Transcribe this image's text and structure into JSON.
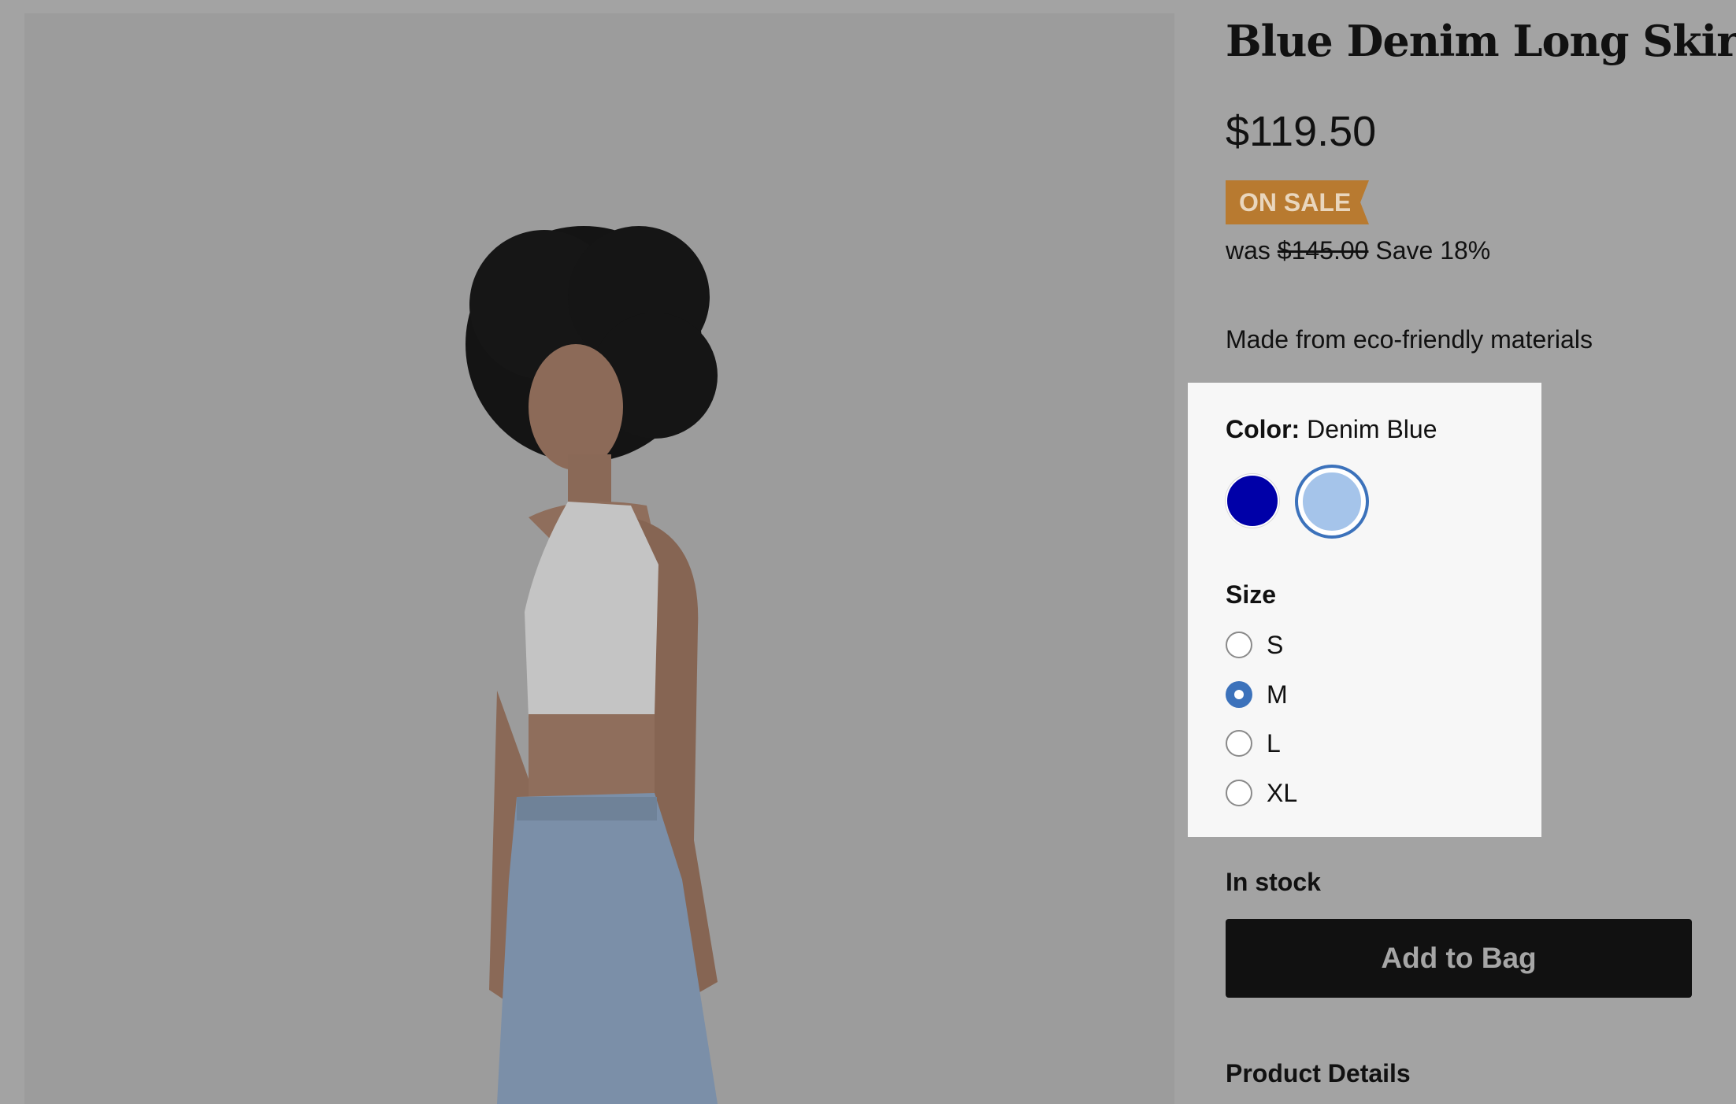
{
  "product": {
    "title": "Blue Denim Long Skirt",
    "price": "$119.50",
    "sale_badge": "ON SALE",
    "was_prefix": "was",
    "was_price": "$145.00",
    "savings": "Save 18%",
    "eco_note": "Made from eco-friendly materials",
    "image_icon": "model-photo"
  },
  "options": {
    "color_label": "Color:",
    "color_selected": "Denim Blue",
    "swatches": [
      {
        "color": "#0000a8",
        "selected": false
      },
      {
        "color": "#a5c4ea",
        "selected": true
      }
    ],
    "size_label": "Size",
    "sizes": [
      {
        "label": "S",
        "selected": false
      },
      {
        "label": "M",
        "selected": true
      },
      {
        "label": "L",
        "selected": false
      },
      {
        "label": "XL",
        "selected": false
      }
    ]
  },
  "stock_status": "In stock",
  "cta_label": "Add to Bag",
  "details_heading": "Product Details",
  "colors": {
    "overlay": "#a3a3a3",
    "panel": "#f7f7f7",
    "sale_badge": "#b87a30",
    "accent": "#3c72bb",
    "button": "#111111"
  }
}
